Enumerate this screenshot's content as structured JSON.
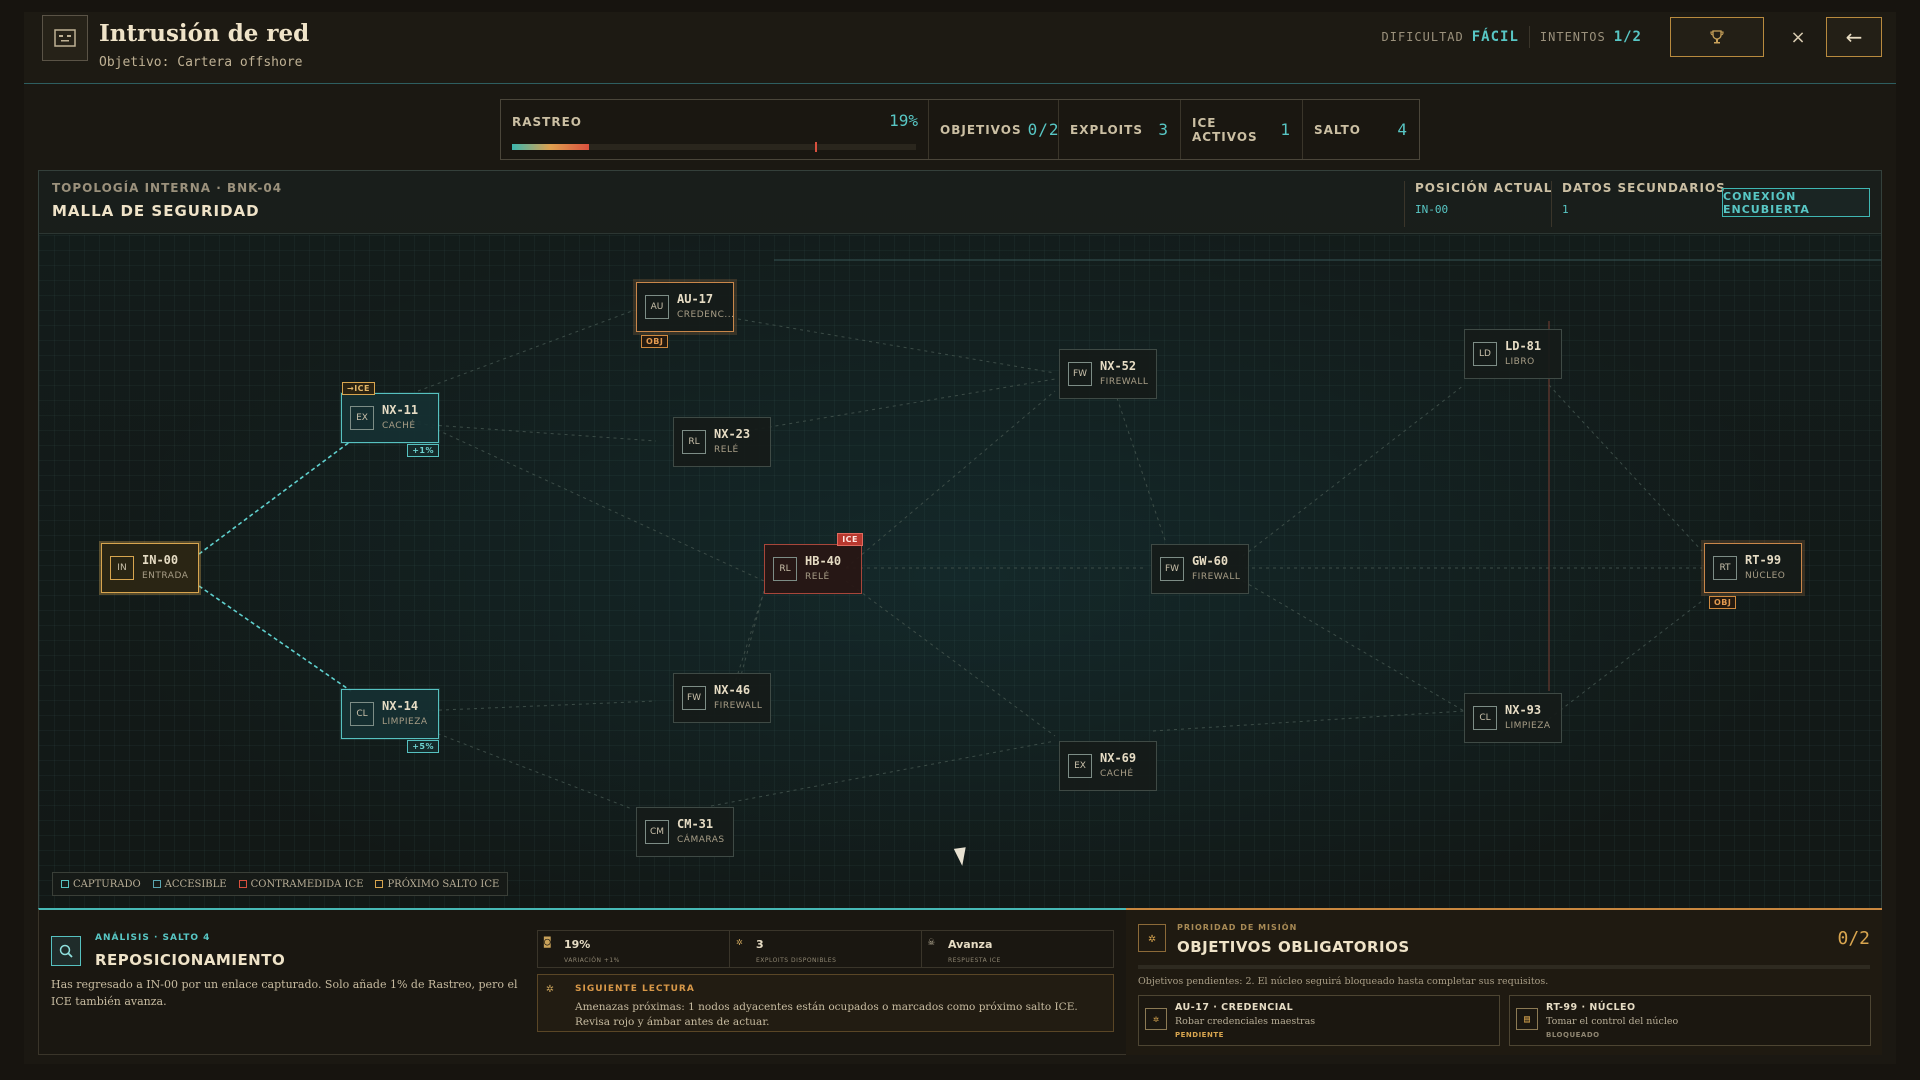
{
  "header": {
    "title": "Intrusión de red",
    "objective": "Objetivo: Cartera offshore",
    "difficulty_label": "DIFICULTAD",
    "difficulty_value": "FÁCIL",
    "attempts_label": "INTENTOS",
    "attempts_value": "1/2",
    "icon": "masked-face-icon",
    "trophy_icon": "trophy-icon",
    "close_icon": "close-icon",
    "back_icon": "arrow-left-icon",
    "close_glyph": "×",
    "back_glyph": "←"
  },
  "status": {
    "trace_label": "RASTREO",
    "trace_value": "19%",
    "trace_fraction": 0.19,
    "trace_marker_fraction": 0.75,
    "objectives_label": "OBJETIVOS",
    "objectives_value": "0/2",
    "exploits_label": "EXPLOITS",
    "exploits_value": "3",
    "ice_label": "ICE ACTIVOS",
    "ice_value": "1",
    "jump_label": "SALTO",
    "jump_value": "4"
  },
  "map": {
    "crumb": "TOPOLOGÍA INTERNA · BNK-04",
    "title": "MALLA DE SEGURIDAD",
    "position_label": "POSICIÓN ACTUAL",
    "position_value": "IN-00",
    "secondary_label": "DATOS SECUNDARIOS",
    "secondary_value": "1",
    "covert_button": "CONEXIÓN ENCUBIERTA",
    "colors": {
      "captured": "#56c1c0",
      "current": "#d8a54f",
      "ice": "#b8382f",
      "objective": "#c9874a"
    },
    "nodes": [
      {
        "id": "IN-00",
        "icon": "IN",
        "type": "ENTRADA",
        "state": "current"
      },
      {
        "id": "NX-11",
        "icon": "EX",
        "type": "CACHÉ",
        "state": "captured",
        "tag_top": "→ICE",
        "tag_bonus": "+1%"
      },
      {
        "id": "NX-14",
        "icon": "CL",
        "type": "LIMPIEZA",
        "state": "captured",
        "tag_bonus": "+5%"
      },
      {
        "id": "AU-17",
        "icon": "AU",
        "type": "CREDENC...",
        "state": "objective",
        "tag_obj": "OBJ"
      },
      {
        "id": "NX-23",
        "icon": "RL",
        "type": "RELÉ",
        "state": "normal"
      },
      {
        "id": "HB-40",
        "icon": "RL",
        "type": "RELÉ",
        "state": "ice",
        "tag_ice": "ICE"
      },
      {
        "id": "NX-46",
        "icon": "FW",
        "type": "FIREWALL",
        "state": "normal"
      },
      {
        "id": "CM-31",
        "icon": "CM",
        "type": "CÁMARAS",
        "state": "normal"
      },
      {
        "id": "NX-52",
        "icon": "FW",
        "type": "FIREWALL",
        "state": "normal"
      },
      {
        "id": "GW-60",
        "icon": "FW",
        "type": "FIREWALL",
        "state": "normal"
      },
      {
        "id": "NX-69",
        "icon": "EX",
        "type": "CACHÉ",
        "state": "normal"
      },
      {
        "id": "LD-81",
        "icon": "LD",
        "type": "LIBRO",
        "state": "normal"
      },
      {
        "id": "NX-93",
        "icon": "CL",
        "type": "LIMPIEZA",
        "state": "normal"
      },
      {
        "id": "RT-99",
        "icon": "RT",
        "type": "NÚCLEO",
        "state": "objective",
        "tag_obj": "OBJ"
      }
    ],
    "legend": [
      "CAPTURADO",
      "ACCESIBLE",
      "CONTRAMEDIDA ICE",
      "PRÓXIMO SALTO ICE"
    ]
  },
  "analysis": {
    "kicker": "ANÁLISIS · SALTO 4",
    "title": "REPOSICIONAMIENTO",
    "text": "Has regresado a IN-00 por un enlace capturado. Solo añade 1% de Rastreo, pero el ICE también avanza.",
    "icon": "search-icon",
    "metrics": [
      {
        "icon": "mask-icon",
        "value": "19%",
        "label": "VARIACIÓN +1%"
      },
      {
        "icon": "gear-icon",
        "value": "3",
        "label": "EXPLOITS DISPONIBLES"
      },
      {
        "icon": "skull-icon",
        "value": "Avanza",
        "label": "RESPUESTA ICE"
      }
    ],
    "next_kicker": "SIGUIENTE LECTURA",
    "next_text": "Amenazas próximas: 1 nodos adyacentes están ocupados o marcados como próximo salto ICE. Revisa rojo y ámbar antes de actuar."
  },
  "objectives": {
    "kicker": "PRIORIDAD DE MISIÓN",
    "title": "OBJETIVOS OBLIGATORIOS",
    "count": "0/2",
    "progress_fraction": 0,
    "note": "Objetivos pendientes: 2. El núcleo seguirá bloqueado hasta completar sus requisitos.",
    "cards": [
      {
        "name": "AU-17 · CREDENCIAL",
        "desc": "Robar credenciales maestras",
        "status": "PENDIENTE",
        "status_color": "#d8a54f"
      },
      {
        "name": "RT-99 · NÚCLEO",
        "desc": "Tomar el control del núcleo",
        "status": "BLOQUEADO",
        "status_color": "#8e8571"
      }
    ]
  }
}
